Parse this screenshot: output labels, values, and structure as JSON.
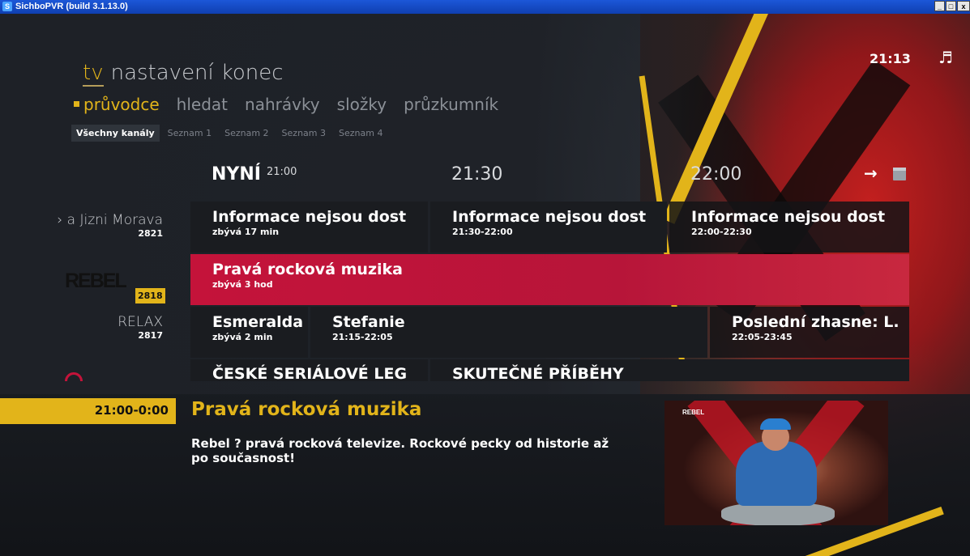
{
  "window": {
    "title": "SichboPVR (build 3.1.13.0)"
  },
  "clock": "21:13",
  "menu": {
    "top": [
      "tv",
      "nastavení",
      "konec"
    ],
    "sub": [
      "průvodce",
      "hledat",
      "nahrávky",
      "složky",
      "průzkumník"
    ],
    "lists": [
      "Všechny kanály",
      "Seznam 1",
      "Seznam 2",
      "Seznam 3",
      "Seznam 4"
    ]
  },
  "timeline": {
    "now_label": "NYNÍ",
    "now_time": "21:00",
    "slot2": "21:30",
    "slot3": "22:00"
  },
  "channels": [
    {
      "name": "› a Jizni Morava",
      "num": "2821",
      "programs": [
        {
          "title": "Informace nejsou dost",
          "sub": "zbývá 17 min"
        },
        {
          "title": "Informace nejsou dost",
          "sub": "21:30-22:00"
        },
        {
          "title": "Informace nejsou dost",
          "sub": "22:00-22:30"
        }
      ]
    },
    {
      "name": "REBEL",
      "num": "2818",
      "programs": [
        {
          "title": "Pravá rocková muzika",
          "sub": "zbývá 3 hod"
        }
      ]
    },
    {
      "name": "RELAX",
      "num": "2817",
      "programs": [
        {
          "title": "Esmeralda",
          "sub": "zbývá 2 min"
        },
        {
          "title": "Stefanie",
          "sub": "21:15-22:05"
        },
        {
          "title": "Poslední zhasne: L.",
          "sub": "22:05-23:45"
        }
      ]
    },
    {
      "name": "",
      "num": "",
      "programs": [
        {
          "title": "ČESKÉ SERIÁLOVÉ LEG",
          "sub": ""
        },
        {
          "title": "SKUTEČNÉ PŘÍBĚHY",
          "sub": ""
        }
      ]
    }
  ],
  "detail": {
    "time": "21:00-0:00",
    "title": "Pravá rocková muzika",
    "description": "Rebel ? pravá rocková televize. Rockové pecky od historie až po současnost!"
  },
  "preview": {
    "logo": "REBEL"
  },
  "colors": {
    "accent": "#e2b41a",
    "selected": "#c4133a"
  },
  "icons": {
    "music": "music-note-icon",
    "arrow": "arrow-right-icon",
    "calendar": "calendar-icon"
  }
}
